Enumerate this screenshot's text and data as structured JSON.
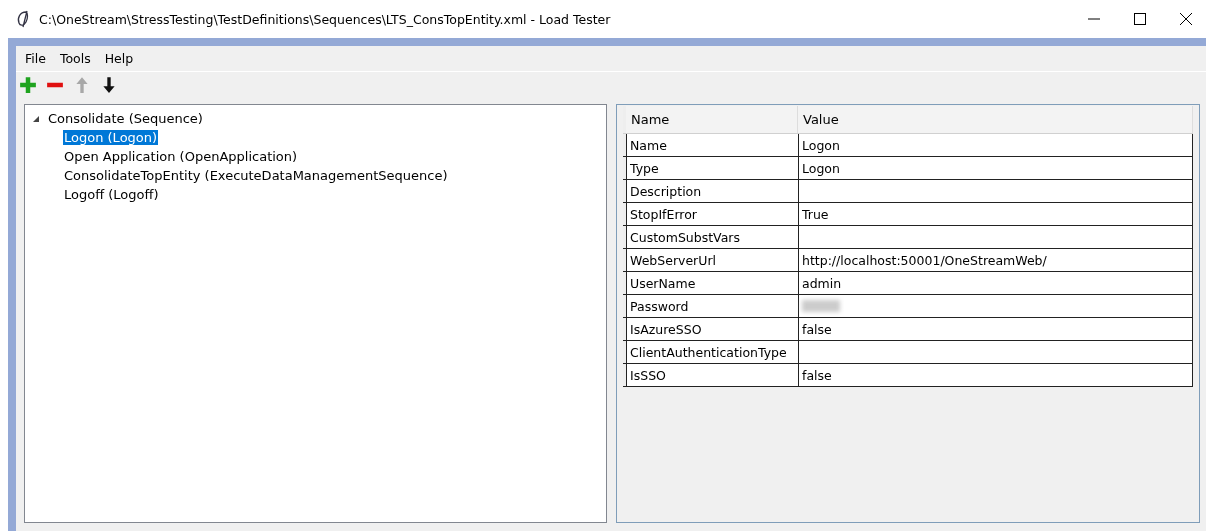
{
  "window": {
    "title": "C:\\OneStream\\StressTesting\\TestDefinitions\\Sequences\\LTS_ConsTopEntity.xml - Load Tester"
  },
  "menu": [
    "File",
    "Tools",
    "Help"
  ],
  "toolbar": [
    {
      "kind": "add",
      "disabled": false
    },
    {
      "kind": "remove",
      "disabled": false
    },
    {
      "kind": "up",
      "disabled": true
    },
    {
      "kind": "down",
      "disabled": false
    }
  ],
  "tree": [
    {
      "label": "Consolidate (Sequence)",
      "expanded": true,
      "selected": false,
      "children": [
        {
          "label": "Logon (Logon)",
          "selected": true
        },
        {
          "label": "Open Application (OpenApplication)",
          "selected": false
        },
        {
          "label": "ConsolidateTopEntity (ExecuteDataManagementSequence)",
          "selected": false
        },
        {
          "label": "Logoff (Logoff)",
          "selected": false
        }
      ]
    }
  ],
  "properties": {
    "columns": [
      "Name",
      "Value"
    ],
    "rows": [
      {
        "name": "Name",
        "value": "Logon"
      },
      {
        "name": "Type",
        "value": "Logon"
      },
      {
        "name": "Description"
      },
      {
        "name": "StopIfError",
        "value": "True"
      },
      {
        "name": "CustomSubstVars"
      },
      {
        "name": "WebServerUrl",
        "value": "http://localhost:50001/OneStreamWeb/"
      },
      {
        "name": "UserName",
        "value": "admin"
      },
      {
        "name": "Password",
        "masked": true
      },
      {
        "name": "IsAzureSSO",
        "value": "false"
      },
      {
        "name": "ClientAuthenticationType"
      },
      {
        "name": "IsSSO",
        "value": "false"
      }
    ]
  }
}
